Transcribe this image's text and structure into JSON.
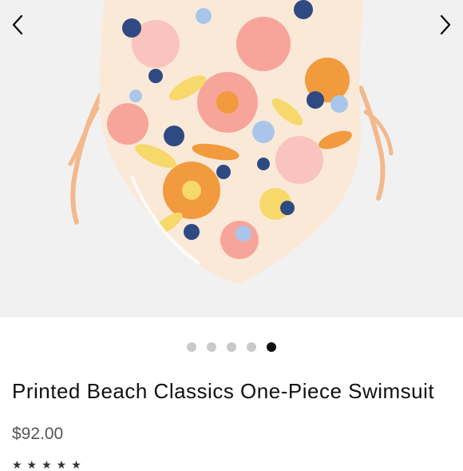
{
  "gallery": {
    "prev_icon": "chevron-left-icon",
    "next_icon": "chevron-right-icon",
    "image_count": 5,
    "active_index": 4,
    "colors": {
      "background": "#f1f1f1",
      "swim_base": "#fbe9d8",
      "orange": "#f29a3e",
      "pink": "#f7a59a",
      "light_pink": "#f9c4bd",
      "yellow": "#f7d96b",
      "navy": "#2f4a82",
      "light_blue": "#a9c6ea"
    }
  },
  "product": {
    "title": "Printed Beach Classics One-Piece Swimsuit",
    "price": "$92.00",
    "rating_glyphs": "★★★★★"
  },
  "colors": {
    "active_dot": "#111111",
    "inactive_dot": "#c9c9c9"
  }
}
